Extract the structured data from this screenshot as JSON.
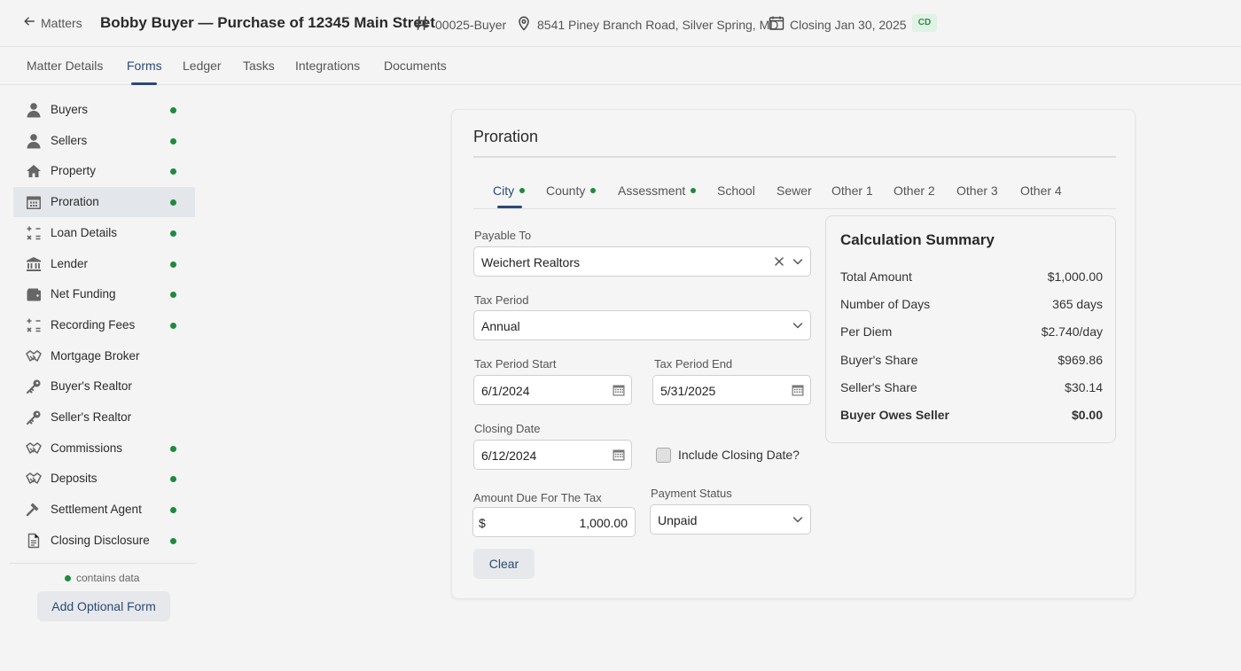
{
  "header": {
    "back_label": "Matters",
    "title": "Bobby Buyer — Purchase of 12345 Main Street",
    "file_number": "00025-Buyer",
    "address": "8541 Piney Branch Road, Silver Spring, MD",
    "closing": "Closing Jan 30, 2025",
    "badge": "CD"
  },
  "top_tabs": [
    {
      "label": "Matter Details"
    },
    {
      "label": "Forms",
      "active": true
    },
    {
      "label": "Ledger"
    },
    {
      "label": "Tasks"
    },
    {
      "label": "Integrations"
    },
    {
      "label": "Documents"
    }
  ],
  "sidebar": {
    "items": [
      {
        "label": "Buyers",
        "icon": "person-icon",
        "has_data": true
      },
      {
        "label": "Sellers",
        "icon": "person-icon",
        "has_data": true
      },
      {
        "label": "Property",
        "icon": "house-icon",
        "has_data": true
      },
      {
        "label": "Proration",
        "icon": "calendar-icon",
        "has_data": true,
        "active": true
      },
      {
        "label": "Loan Details",
        "icon": "calculator-icon",
        "has_data": true
      },
      {
        "label": "Lender",
        "icon": "bank-icon",
        "has_data": true
      },
      {
        "label": "Net Funding",
        "icon": "wallet-icon",
        "has_data": true
      },
      {
        "label": "Recording Fees",
        "icon": "calculator-icon",
        "has_data": true
      },
      {
        "label": "Mortgage Broker",
        "icon": "handshake-icon",
        "has_data": false
      },
      {
        "label": "Buyer's Realtor",
        "icon": "key-icon",
        "has_data": false
      },
      {
        "label": "Seller's Realtor",
        "icon": "key-icon",
        "has_data": false
      },
      {
        "label": "Commissions",
        "icon": "handshake-icon",
        "has_data": true
      },
      {
        "label": "Deposits",
        "icon": "handshake-icon",
        "has_data": true
      },
      {
        "label": "Settlement Agent",
        "icon": "gavel-icon",
        "has_data": true
      },
      {
        "label": "Closing Disclosure",
        "icon": "document-icon",
        "has_data": true
      }
    ],
    "legend": "contains data",
    "add_button": "Add Optional Form"
  },
  "colors": {
    "accent": "#2b4a74",
    "data_dot": "#1f8a3d",
    "badge_bg": "#dff2e4"
  },
  "proration": {
    "title": "Proration",
    "tabs": [
      {
        "label": "City",
        "has_data": true,
        "active": true
      },
      {
        "label": "County",
        "has_data": true
      },
      {
        "label": "Assessment",
        "has_data": true
      },
      {
        "label": "School",
        "has_data": false
      },
      {
        "label": "Sewer",
        "has_data": false
      },
      {
        "label": "Other 1",
        "has_data": false
      },
      {
        "label": "Other 2",
        "has_data": false
      },
      {
        "label": "Other 3",
        "has_data": false
      },
      {
        "label": "Other 4",
        "has_data": false
      }
    ],
    "payable_to": {
      "label": "Payable To",
      "value": "Weichert Realtors"
    },
    "tax_period": {
      "label": "Tax Period",
      "value": "Annual"
    },
    "tax_period_start": {
      "label": "Tax Period Start",
      "value": "6/1/2024"
    },
    "tax_period_end": {
      "label": "Tax Period End",
      "value": "5/31/2025"
    },
    "closing_date": {
      "label": "Closing Date",
      "value": "6/12/2024"
    },
    "include_closing_date": {
      "label": "Include Closing Date?",
      "checked": false
    },
    "amount_due": {
      "label": "Amount Due For The Tax",
      "prefix": "$",
      "value": "1,000.00"
    },
    "payment_status": {
      "label": "Payment Status",
      "value": "Unpaid"
    },
    "clear_button": "Clear"
  },
  "summary": {
    "title": "Calculation Summary",
    "rows": [
      {
        "key": "Total Amount",
        "value": "$1,000.00"
      },
      {
        "key": "Number of Days",
        "value": "365 days"
      },
      {
        "key": "Per Diem",
        "value": "$2.740/day"
      },
      {
        "key": "Buyer's Share",
        "value": "$969.86"
      },
      {
        "key": "Seller's Share",
        "value": "$30.14"
      },
      {
        "key": "Buyer Owes Seller",
        "value": "$0.00",
        "bold": true
      }
    ]
  }
}
